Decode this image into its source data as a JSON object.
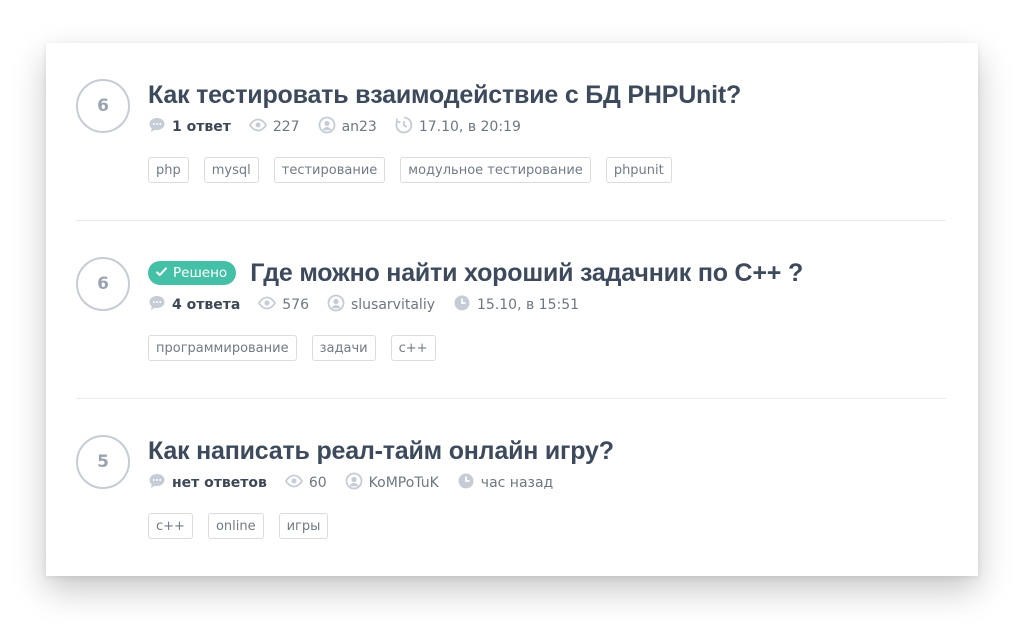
{
  "colors": {
    "accent": "#44c0a7",
    "title": "#3d4a5c",
    "muted": "#9aa4b1"
  },
  "questions": [
    {
      "votes": "6",
      "solved": false,
      "title": "Как тестировать взаимодействие с БД PHPUnit?",
      "answers": "1 ответ",
      "views": "227",
      "author": "an23",
      "date": "17.10, в 20:19",
      "tags": [
        "php",
        "mysql",
        "тестирование",
        "модульное тестирование",
        "phpunit"
      ]
    },
    {
      "votes": "6",
      "solved": true,
      "solved_label": "Решено",
      "title": "Где можно найти хороший задачник по C++ ?",
      "answers": "4 ответа",
      "views": "576",
      "author": "slusarvitaliy",
      "date": "15.10, в 15:51",
      "tags": [
        "программирование",
        "задачи",
        "c++"
      ]
    },
    {
      "votes": "5",
      "solved": false,
      "title": "Как написать реал-тайм онлайн игру?",
      "answers": "нет ответов",
      "views": "60",
      "author": "KoMPoTuK",
      "date": "час назад",
      "tags": [
        "c++",
        "online",
        "игры"
      ]
    }
  ]
}
